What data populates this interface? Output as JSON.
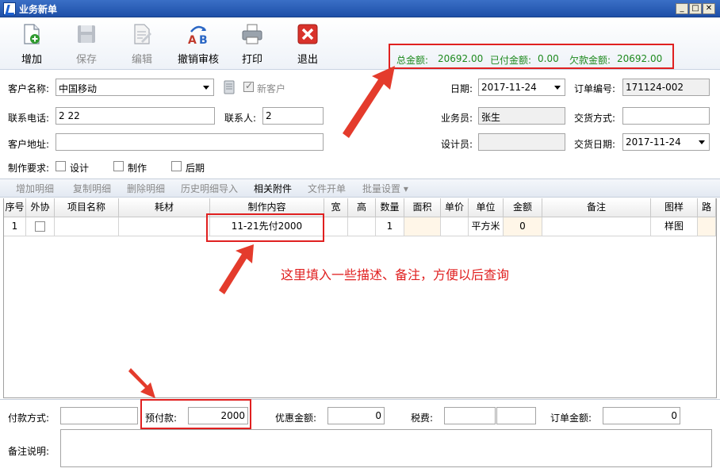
{
  "window": {
    "title": "业务新单",
    "min": "_",
    "max": "□",
    "close": "✕"
  },
  "toolbar": {
    "add": "增加",
    "save": "保存",
    "edit": "编辑",
    "revoke": "撤销审核",
    "print": "打印",
    "exit": "退出"
  },
  "summary": {
    "total_label": "总金额:",
    "total_value": "20692.00",
    "paid_label": "已付金额:",
    "paid_value": "0.00",
    "owed_label": "欠款金额:",
    "owed_value": "20692.00"
  },
  "form": {
    "customer_label": "客户名称:",
    "customer_value": "中国移动",
    "new_customer_label": "新客户",
    "date_label": "日期:",
    "date_value": "2017-11-24",
    "order_no_label": "订单编号:",
    "order_no_value": "171124-002",
    "phone_label": "联系电话:",
    "phone_value": "2 22",
    "contact_label": "联系人:",
    "contact_value": "2",
    "salesman_label": "业务员:",
    "salesman_value": "张生",
    "delivery_method_label": "交货方式:",
    "delivery_method_value": "",
    "address_label": "客户地址:",
    "address_value": "",
    "designer_label": "设计员:",
    "designer_value": "",
    "delivery_date_label": "交货日期:",
    "delivery_date_value": "2017-11-24",
    "requirements_label": "制作要求:",
    "req_design": "设计",
    "req_make": "制作",
    "req_post": "后期"
  },
  "detail_toolbar": {
    "add": "增加明细",
    "copy": "复制明细",
    "delete": "删除明细",
    "history": "历史明细导入",
    "attachments": "相关附件",
    "file_open": "文件开单",
    "batch": "批量设置 ▾"
  },
  "table": {
    "columns": [
      "序号",
      "外协",
      "项目名称",
      "耗材",
      "制作内容",
      "宽",
      "高",
      "数量",
      "面积",
      "单价",
      "单位",
      "金额",
      "备注",
      "图样",
      "路"
    ],
    "rows": [
      {
        "seq": "1",
        "outsource": "",
        "project": "",
        "material": "",
        "content": "11-21先付2000",
        "width": "",
        "height": "",
        "qty": "1",
        "area": "",
        "price": "",
        "unit": "平方米",
        "amount": "0",
        "note": "",
        "sample": "样图",
        "route": ""
      }
    ]
  },
  "annotation": "这里填入一些描述、备注，方便以后查询",
  "bottom": {
    "payment_method_label": "付款方式:",
    "payment_method_value": "",
    "prepaid_label": "预付款:",
    "prepaid_value": "2000",
    "discount_label": "优惠金额:",
    "discount_value": "0",
    "tax_label": "税费:",
    "tax_value_1": "",
    "tax_value_2": "",
    "order_amount_label": "订单金额:",
    "order_amount_value": "0",
    "remark_label": "备注说明:",
    "remark_value": ""
  }
}
